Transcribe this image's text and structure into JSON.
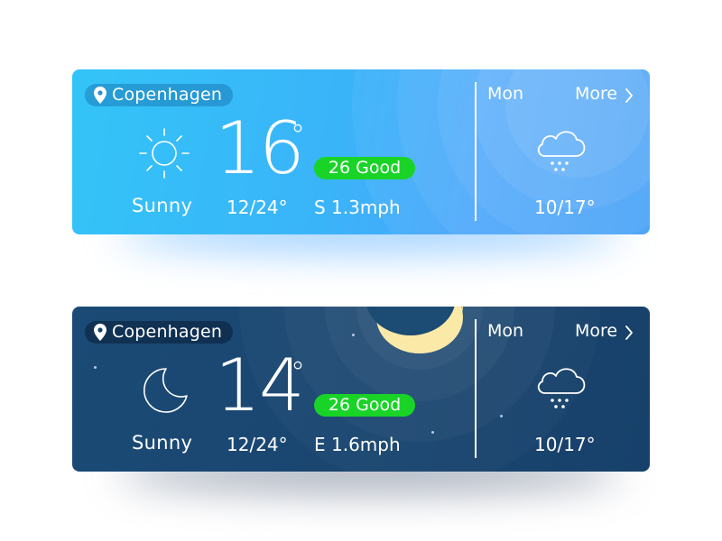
{
  "cards": [
    {
      "theme": "day",
      "location": "Copenhagen",
      "condition_icon": "sun-icon",
      "condition": "Sunny",
      "temperature": "16",
      "degree_symbol": "°",
      "temp_range": "12/24°",
      "aqi_label": "26 Good",
      "wind": "S 1.3mph",
      "forecast": {
        "day": "Mon",
        "more": "More",
        "icon": "snow-cloud-icon",
        "range": "10/17°"
      },
      "colors": {
        "accent": "#19d427",
        "background_start": "#33c4f7",
        "background_end": "#3a9cf7"
      }
    },
    {
      "theme": "night",
      "location": "Copenhagen",
      "condition_icon": "crescent-moon-icon",
      "condition": "Sunny",
      "temperature": "14",
      "degree_symbol": "°",
      "temp_range": "12/24°",
      "aqi_label": "26 Good",
      "wind": "E 1.6mph",
      "forecast": {
        "day": "Mon",
        "more": "More",
        "icon": "snow-cloud-icon",
        "range": "10/17°"
      },
      "colors": {
        "accent": "#19d427",
        "background_start": "#1a4a75",
        "background_end": "#17416a",
        "moon": "#fbe9a8"
      }
    }
  ]
}
